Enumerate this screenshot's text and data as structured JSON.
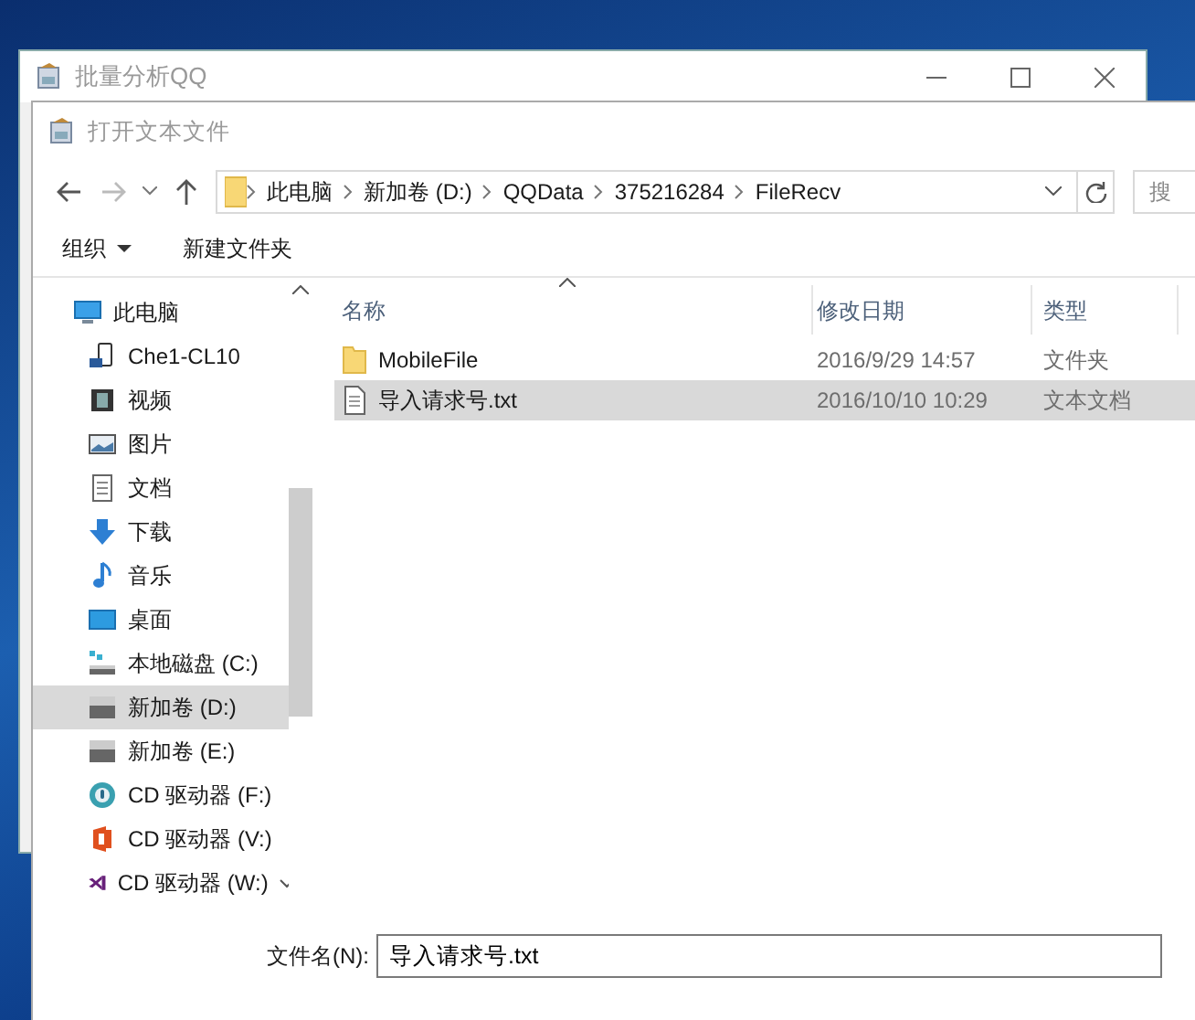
{
  "parent_window": {
    "title": "批量分析QQ"
  },
  "dialog": {
    "title": "打开文本文件",
    "address": {
      "segments": [
        "此电脑",
        "新加卷 (D:)",
        "QQData",
        "375216284",
        "FileRecv"
      ]
    },
    "search": {
      "placeholder": "搜"
    },
    "toolbar": [
      {
        "label": "组织",
        "kind": "menu"
      },
      {
        "label": "新建文件夹",
        "kind": "button"
      }
    ],
    "sidebar": {
      "items": [
        {
          "label": "此电脑",
          "kind": "computer",
          "selected": false,
          "children": [
            {
              "label": "Che1-CL10",
              "kind": "phone",
              "selected": false
            },
            {
              "label": "视频",
              "kind": "video",
              "selected": false
            },
            {
              "label": "图片",
              "kind": "pictures",
              "selected": false
            },
            {
              "label": "文档",
              "kind": "documents",
              "selected": false
            },
            {
              "label": "下载",
              "kind": "downloads",
              "selected": false
            },
            {
              "label": "音乐",
              "kind": "music",
              "selected": false
            },
            {
              "label": "桌面",
              "kind": "desktop",
              "selected": false
            },
            {
              "label": "本地磁盘 (C:)",
              "kind": "system-disk",
              "selected": false
            },
            {
              "label": "新加卷 (D:)",
              "kind": "disk",
              "selected": true
            },
            {
              "label": "新加卷 (E:)",
              "kind": "disk",
              "selected": false
            },
            {
              "label": "CD 驱动器 (F:)",
              "kind": "cd-round",
              "selected": false
            },
            {
              "label": "CD 驱动器 (V:)",
              "kind": "cd-office",
              "selected": false
            },
            {
              "label": "CD 驱动器 (W:)",
              "kind": "cd-studio",
              "selected": false
            }
          ]
        }
      ]
    },
    "table": {
      "columns": [
        "名称",
        "修改日期",
        "类型"
      ],
      "rows": [
        {
          "kind": "folder",
          "name": "MobileFile",
          "date": "2016/9/29 14:57",
          "type": "文件夹",
          "selected": false
        },
        {
          "kind": "text-file",
          "name": "导入请求号.txt",
          "date": "2016/10/10 10:29",
          "type": "文本文档",
          "selected": true
        }
      ]
    },
    "filename": {
      "label": "文件名(N):",
      "value": "导入请求号.txt"
    }
  }
}
